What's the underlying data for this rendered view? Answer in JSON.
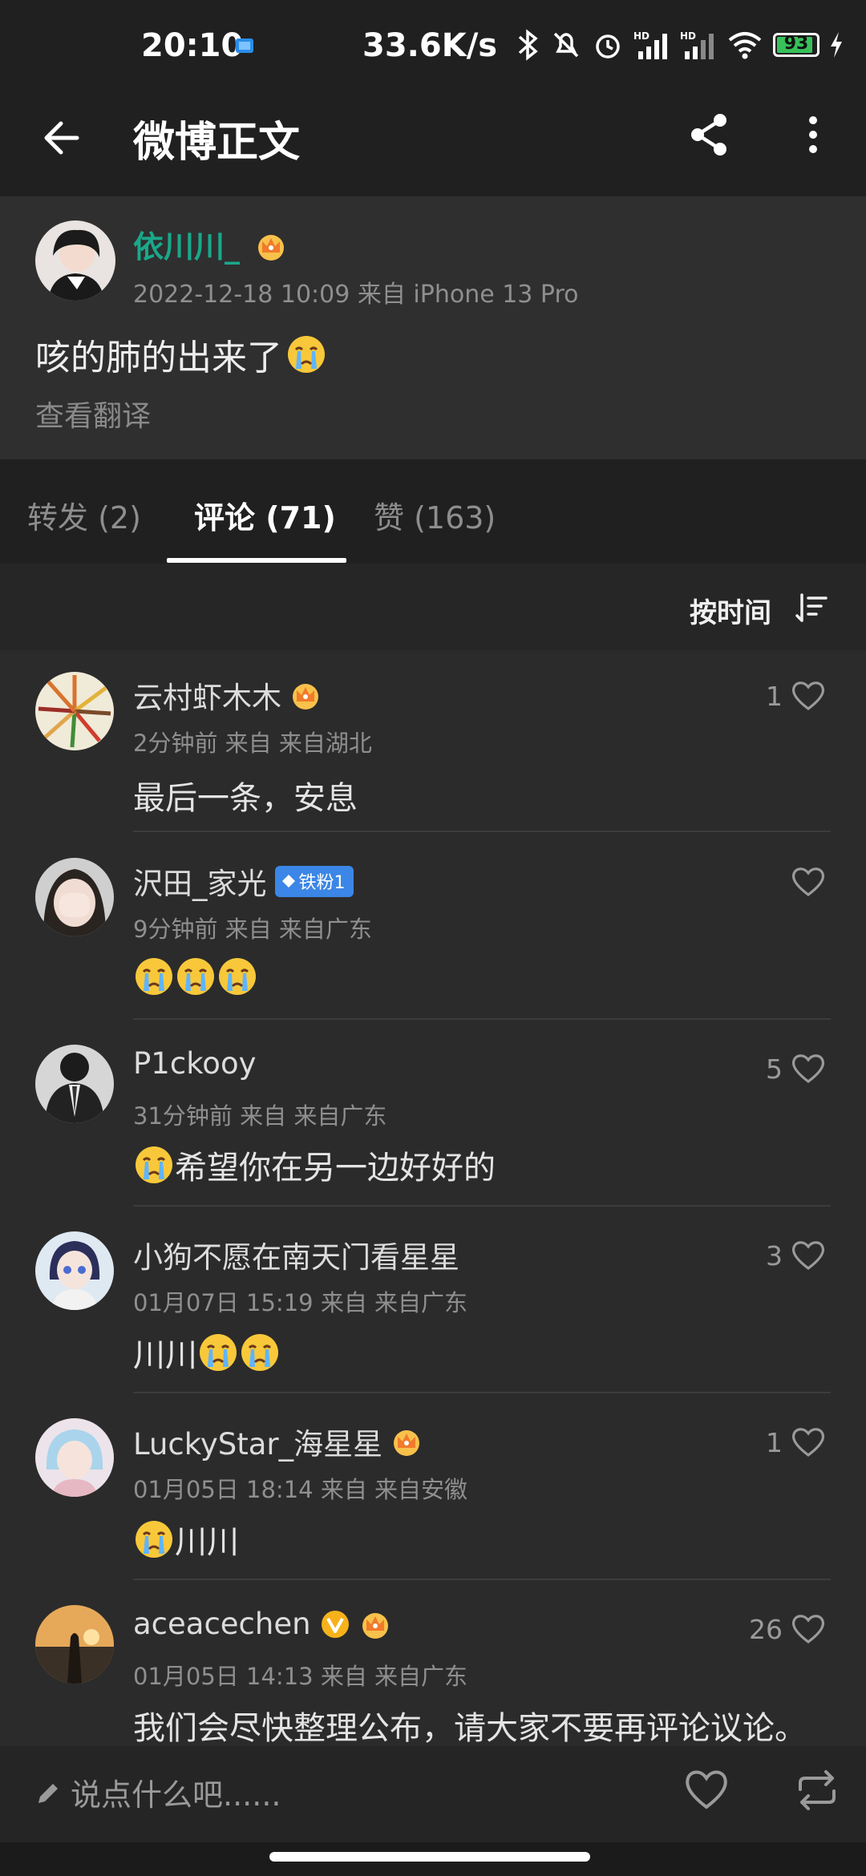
{
  "status_bar": {
    "time": "20:10",
    "net_speed": "33.6K/s",
    "battery": "93",
    "battery_fraction": 0.93,
    "icons": [
      "app-notification-icon",
      "bluetooth-icon",
      "mute-icon",
      "alarm-icon",
      "hd-signal-icon",
      "hd-signal-icon",
      "wifi-icon",
      "battery-icon",
      "charging-icon"
    ]
  },
  "header": {
    "title": "微博正文",
    "icons": [
      "back-arrow-icon",
      "share-icon",
      "more-vertical-icon"
    ]
  },
  "post": {
    "author": "依川川_",
    "meta": "2022-12-18 10:09  来自 iPhone 13 Pro",
    "text": "咳的肺的出来了",
    "translate": "查看翻译"
  },
  "tabs": [
    {
      "label": "转发 (2)"
    },
    {
      "label": "评论 (71)"
    },
    {
      "label": "赞 (163)"
    }
  ],
  "sort": {
    "label": "按时间"
  },
  "comments": [
    {
      "name": "云村虾木木",
      "meta": "2分钟前 来自 来自湖北",
      "text": "最后一条，安息",
      "likes": "1",
      "badge": "crown"
    },
    {
      "name": "沢田_家光",
      "meta": "9分钟前 来自 来自广东",
      "text": "",
      "likes": "",
      "badge": "fan",
      "fan_label": "铁粉1"
    },
    {
      "name": "P1ckooy",
      "meta": "31分钟前 来自 来自广东",
      "text": "希望你在另一边好好的",
      "likes": "5",
      "badge": ""
    },
    {
      "name": "小狗不愿在南天门看星星",
      "meta": "01月07日 15:19 来自 来自广东",
      "text": "川川",
      "likes": "3",
      "badge": ""
    },
    {
      "name": "LuckyStar_海星星",
      "meta": "01月05日 18:14 来自 来自安徽",
      "text": "川川",
      "likes": "1",
      "badge": "crown"
    },
    {
      "name": "aceacechen",
      "meta": "01月05日 14:13 来自 来自广东",
      "text": "我们会尽快整理公布，请大家不要再评论议论。",
      "likes": "26",
      "badge": "v-crown"
    }
  ],
  "bottom_bar": {
    "placeholder": "说点什么吧......"
  },
  "colors": {
    "accent": "#19a88a",
    "background": "#2b2b2b",
    "bar": "#202020",
    "fan_badge": "#3b86e6",
    "crown": "#f4a93a"
  }
}
